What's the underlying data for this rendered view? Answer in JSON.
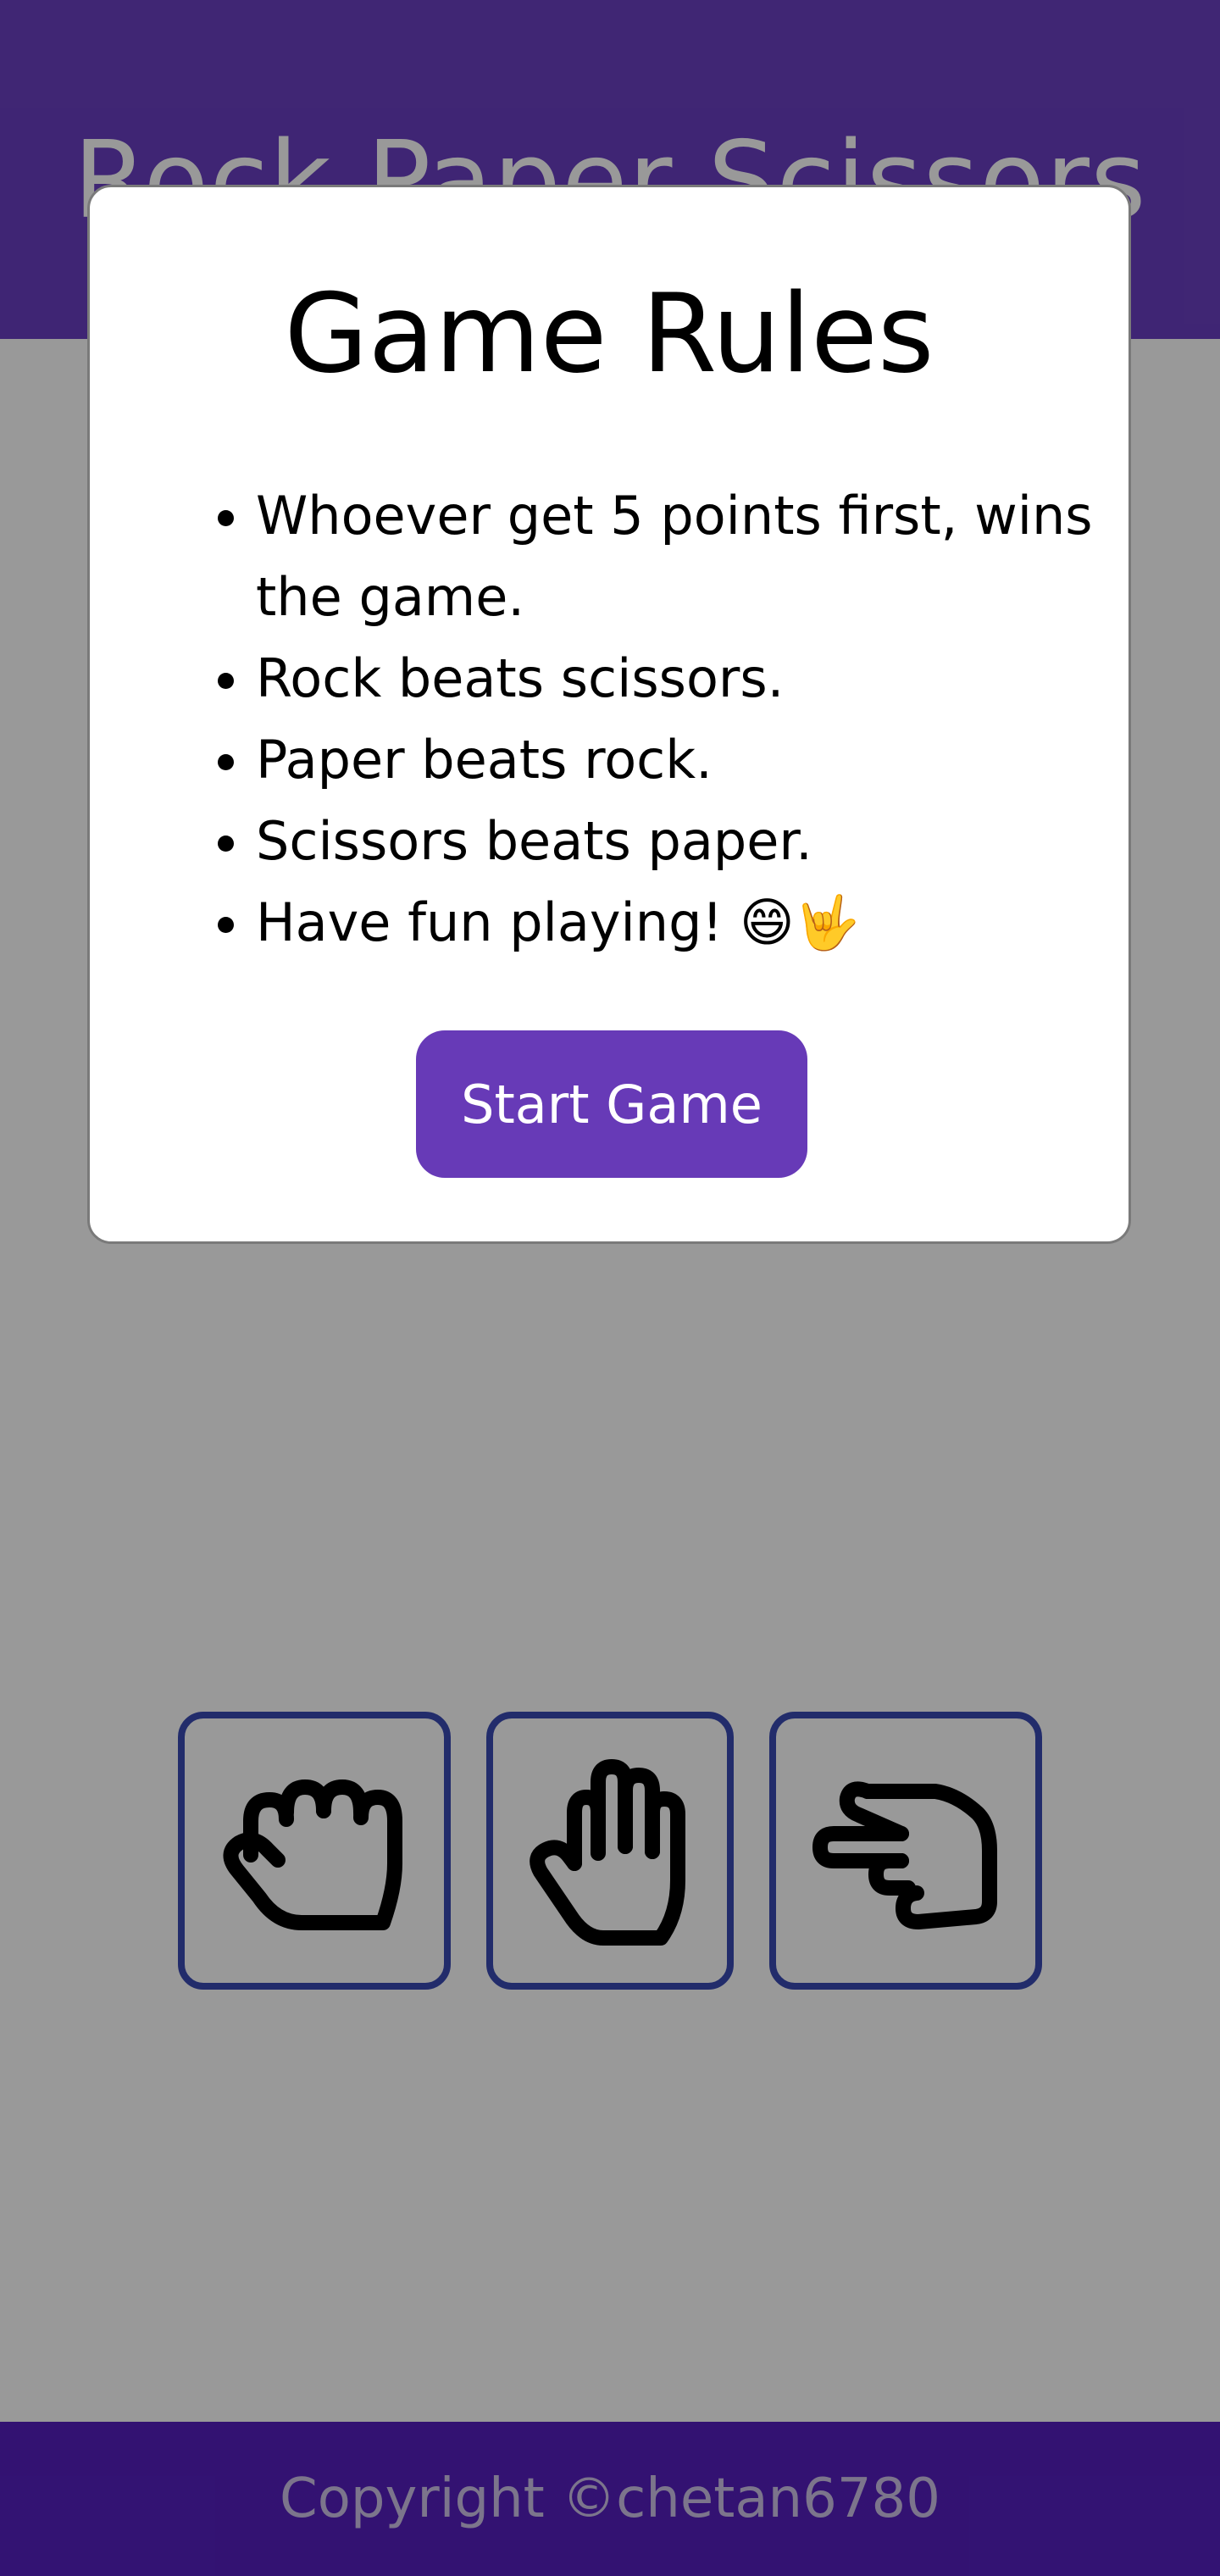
{
  "header": {
    "title": "Rock Paper Scissors"
  },
  "choices": [
    {
      "name": "rock",
      "icon": "rock-hand-icon"
    },
    {
      "name": "paper",
      "icon": "paper-hand-icon"
    },
    {
      "name": "scissors",
      "icon": "scissors-hand-icon"
    }
  ],
  "footer": {
    "copyright": "Copyright ©chetan6780"
  },
  "modal": {
    "title": "Game Rules",
    "rules": [
      "Whoever get 5 points first, wins the game.",
      "Rock beats scissors.",
      "Paper beats rock.",
      "Scissors beats paper.",
      "Have fun playing! 😄🤟"
    ],
    "start_button": "Start Game"
  },
  "colors": {
    "header_bg": "#6a3fc2",
    "footer_bg": "#551fbf",
    "button_bg": "#673ab7",
    "choice_border": "#3a4ab2",
    "overlay": "rgba(0,0,0,0.4)"
  }
}
